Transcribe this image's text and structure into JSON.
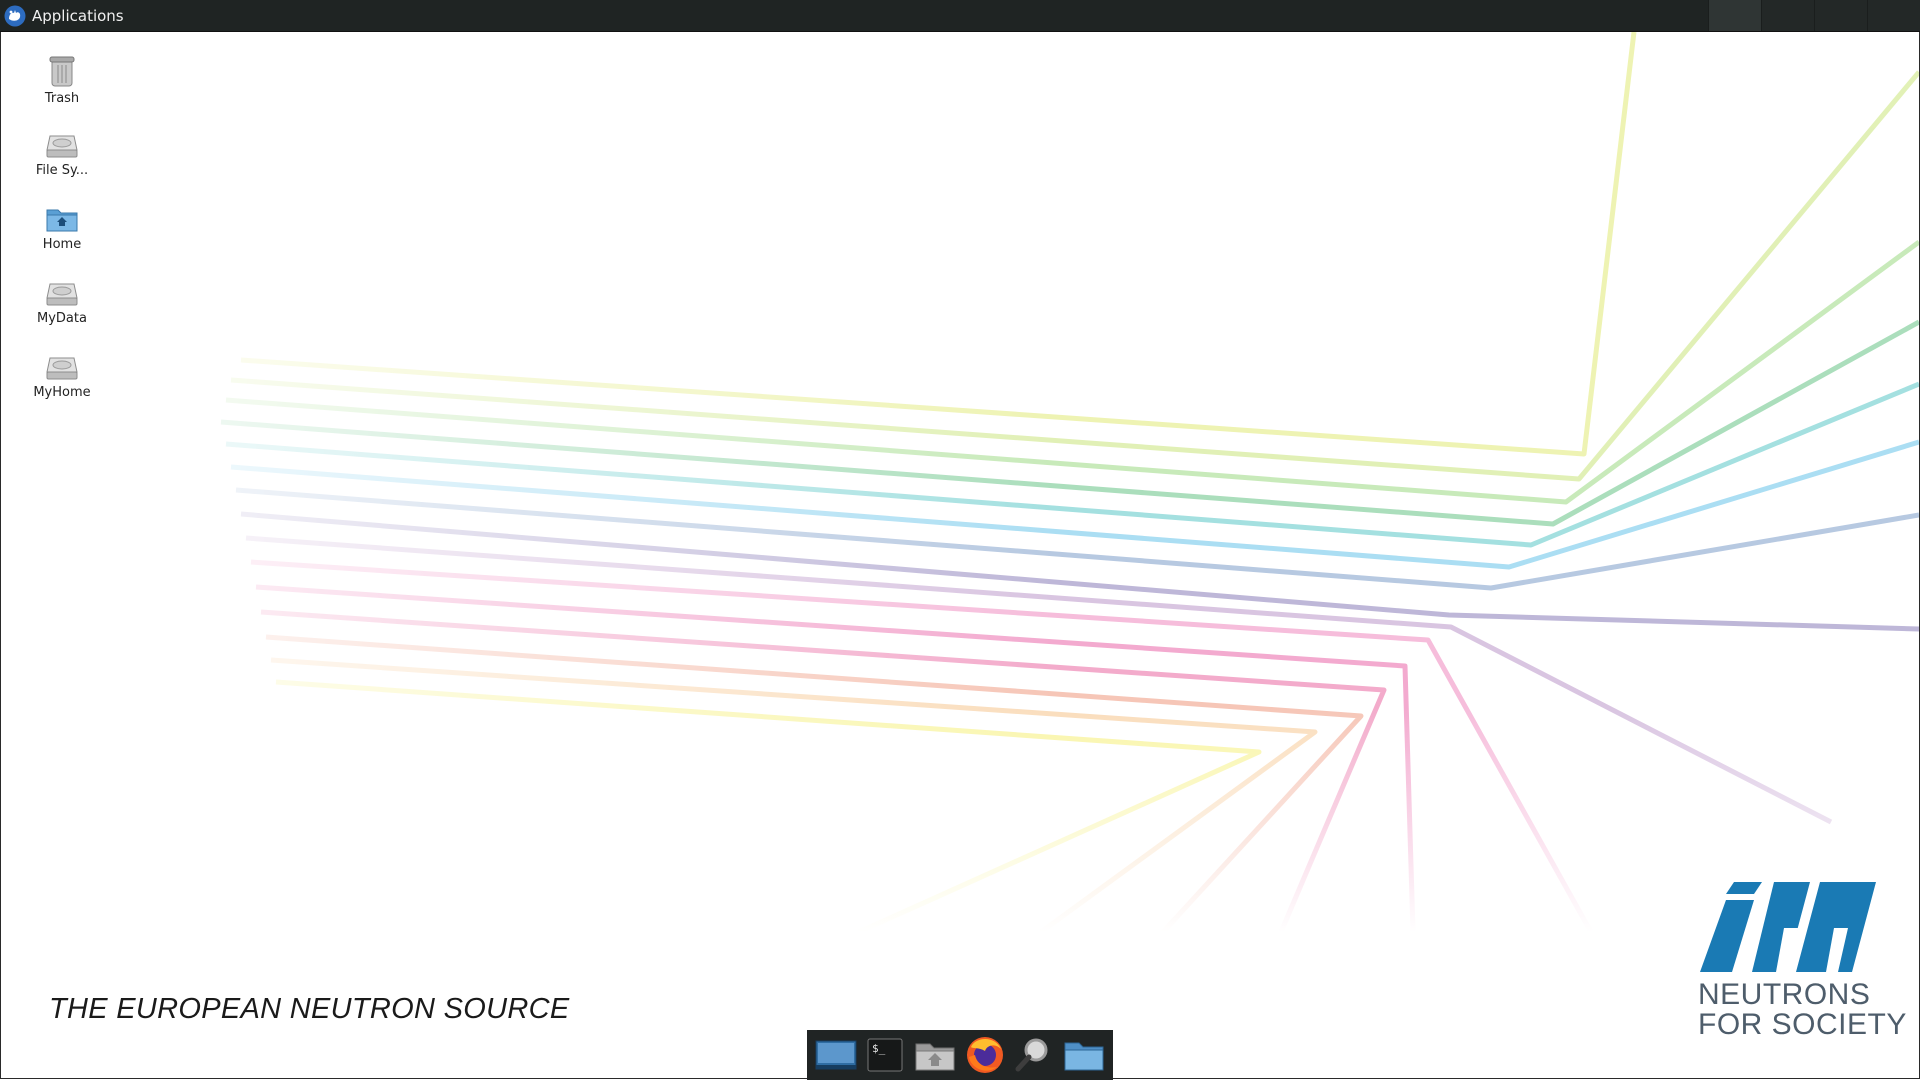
{
  "top_panel": {
    "menu_label": "Applications",
    "workspaces": 4
  },
  "desktop_icons": [
    {
      "label": "Trash",
      "icon": "trash-icon"
    },
    {
      "label": "File Sy...",
      "icon": "drive-icon"
    },
    {
      "label": "Home",
      "icon": "home-folder-icon"
    },
    {
      "label": "MyData",
      "icon": "drive-icon"
    },
    {
      "label": "MyHome",
      "icon": "drive-icon"
    }
  ],
  "branding": {
    "tagline": "THE EUROPEAN NEUTRON SOURCE",
    "logo_text": "ill",
    "slogan_line1": "NEUTRONS",
    "slogan_line2": "FOR SOCIETY",
    "logo_color": "#1a7ab4"
  },
  "dock": {
    "items": [
      "show-desktop-icon",
      "terminal-icon",
      "home-folder-icon",
      "firefox-icon",
      "search-icon",
      "files-icon"
    ]
  }
}
